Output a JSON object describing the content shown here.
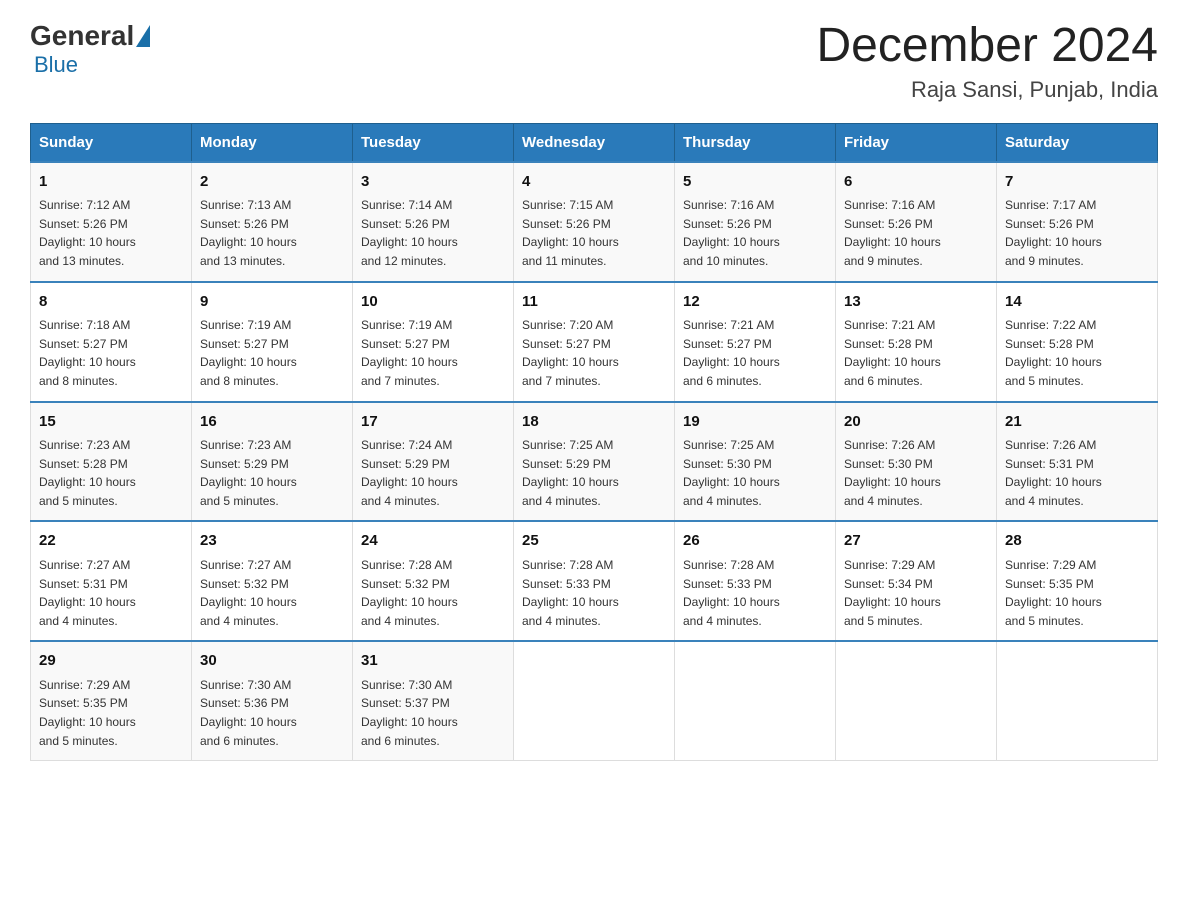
{
  "logo": {
    "general": "General",
    "blue": "Blue"
  },
  "title": "December 2024",
  "location": "Raja Sansi, Punjab, India",
  "weekdays": [
    "Sunday",
    "Monday",
    "Tuesday",
    "Wednesday",
    "Thursday",
    "Friday",
    "Saturday"
  ],
  "weeks": [
    [
      {
        "day": "1",
        "sunrise": "7:12 AM",
        "sunset": "5:26 PM",
        "daylight": "10 hours and 13 minutes."
      },
      {
        "day": "2",
        "sunrise": "7:13 AM",
        "sunset": "5:26 PM",
        "daylight": "10 hours and 13 minutes."
      },
      {
        "day": "3",
        "sunrise": "7:14 AM",
        "sunset": "5:26 PM",
        "daylight": "10 hours and 12 minutes."
      },
      {
        "day": "4",
        "sunrise": "7:15 AM",
        "sunset": "5:26 PM",
        "daylight": "10 hours and 11 minutes."
      },
      {
        "day": "5",
        "sunrise": "7:16 AM",
        "sunset": "5:26 PM",
        "daylight": "10 hours and 10 minutes."
      },
      {
        "day": "6",
        "sunrise": "7:16 AM",
        "sunset": "5:26 PM",
        "daylight": "10 hours and 9 minutes."
      },
      {
        "day": "7",
        "sunrise": "7:17 AM",
        "sunset": "5:26 PM",
        "daylight": "10 hours and 9 minutes."
      }
    ],
    [
      {
        "day": "8",
        "sunrise": "7:18 AM",
        "sunset": "5:27 PM",
        "daylight": "10 hours and 8 minutes."
      },
      {
        "day": "9",
        "sunrise": "7:19 AM",
        "sunset": "5:27 PM",
        "daylight": "10 hours and 8 minutes."
      },
      {
        "day": "10",
        "sunrise": "7:19 AM",
        "sunset": "5:27 PM",
        "daylight": "10 hours and 7 minutes."
      },
      {
        "day": "11",
        "sunrise": "7:20 AM",
        "sunset": "5:27 PM",
        "daylight": "10 hours and 7 minutes."
      },
      {
        "day": "12",
        "sunrise": "7:21 AM",
        "sunset": "5:27 PM",
        "daylight": "10 hours and 6 minutes."
      },
      {
        "day": "13",
        "sunrise": "7:21 AM",
        "sunset": "5:28 PM",
        "daylight": "10 hours and 6 minutes."
      },
      {
        "day": "14",
        "sunrise": "7:22 AM",
        "sunset": "5:28 PM",
        "daylight": "10 hours and 5 minutes."
      }
    ],
    [
      {
        "day": "15",
        "sunrise": "7:23 AM",
        "sunset": "5:28 PM",
        "daylight": "10 hours and 5 minutes."
      },
      {
        "day": "16",
        "sunrise": "7:23 AM",
        "sunset": "5:29 PM",
        "daylight": "10 hours and 5 minutes."
      },
      {
        "day": "17",
        "sunrise": "7:24 AM",
        "sunset": "5:29 PM",
        "daylight": "10 hours and 4 minutes."
      },
      {
        "day": "18",
        "sunrise": "7:25 AM",
        "sunset": "5:29 PM",
        "daylight": "10 hours and 4 minutes."
      },
      {
        "day": "19",
        "sunrise": "7:25 AM",
        "sunset": "5:30 PM",
        "daylight": "10 hours and 4 minutes."
      },
      {
        "day": "20",
        "sunrise": "7:26 AM",
        "sunset": "5:30 PM",
        "daylight": "10 hours and 4 minutes."
      },
      {
        "day": "21",
        "sunrise": "7:26 AM",
        "sunset": "5:31 PM",
        "daylight": "10 hours and 4 minutes."
      }
    ],
    [
      {
        "day": "22",
        "sunrise": "7:27 AM",
        "sunset": "5:31 PM",
        "daylight": "10 hours and 4 minutes."
      },
      {
        "day": "23",
        "sunrise": "7:27 AM",
        "sunset": "5:32 PM",
        "daylight": "10 hours and 4 minutes."
      },
      {
        "day": "24",
        "sunrise": "7:28 AM",
        "sunset": "5:32 PM",
        "daylight": "10 hours and 4 minutes."
      },
      {
        "day": "25",
        "sunrise": "7:28 AM",
        "sunset": "5:33 PM",
        "daylight": "10 hours and 4 minutes."
      },
      {
        "day": "26",
        "sunrise": "7:28 AM",
        "sunset": "5:33 PM",
        "daylight": "10 hours and 4 minutes."
      },
      {
        "day": "27",
        "sunrise": "7:29 AM",
        "sunset": "5:34 PM",
        "daylight": "10 hours and 5 minutes."
      },
      {
        "day": "28",
        "sunrise": "7:29 AM",
        "sunset": "5:35 PM",
        "daylight": "10 hours and 5 minutes."
      }
    ],
    [
      {
        "day": "29",
        "sunrise": "7:29 AM",
        "sunset": "5:35 PM",
        "daylight": "10 hours and 5 minutes."
      },
      {
        "day": "30",
        "sunrise": "7:30 AM",
        "sunset": "5:36 PM",
        "daylight": "10 hours and 6 minutes."
      },
      {
        "day": "31",
        "sunrise": "7:30 AM",
        "sunset": "5:37 PM",
        "daylight": "10 hours and 6 minutes."
      },
      null,
      null,
      null,
      null
    ]
  ],
  "labels": {
    "sunrise": "Sunrise:",
    "sunset": "Sunset:",
    "daylight": "Daylight:"
  }
}
